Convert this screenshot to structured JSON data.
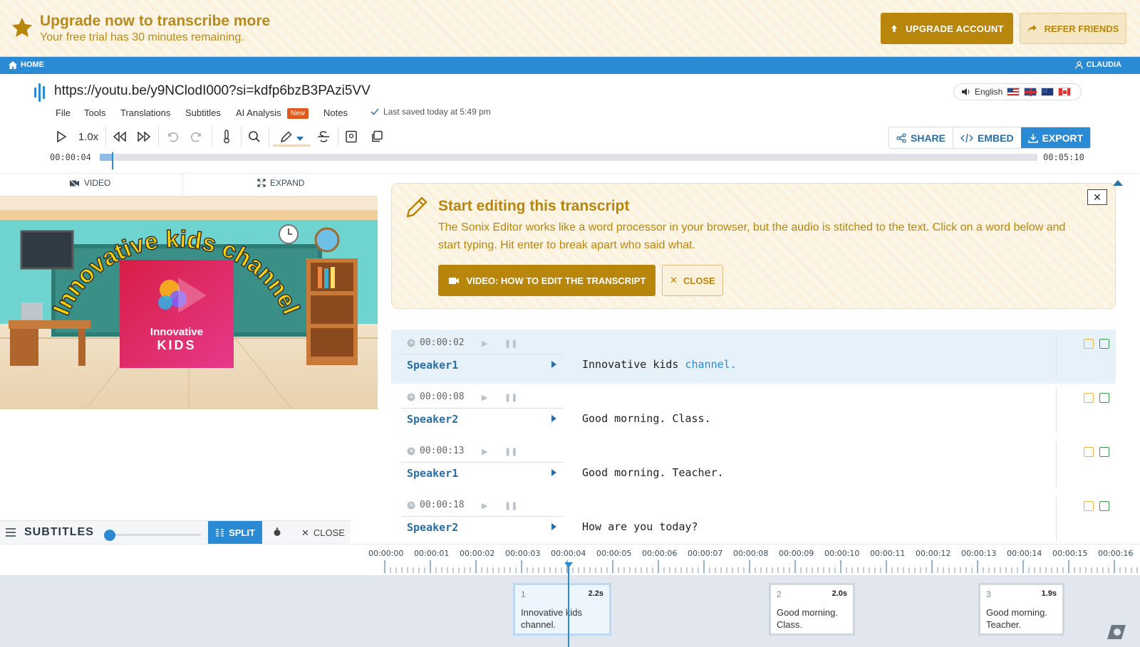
{
  "banner": {
    "title": "Upgrade now to transcribe more",
    "subtitle": "Your free trial has 30 minutes remaining.",
    "upgrade_label": "UPGRADE ACCOUNT",
    "refer_label": "REFER FRIENDS",
    "accent": "#b8860b"
  },
  "nav": {
    "home_label": "HOME",
    "user_label": "CLAUDIA",
    "color": "#2a8ad4"
  },
  "header": {
    "file_title": "https://youtu.be/y9NClodI000?si=kdfp6bzB3PAzi5VV",
    "language": "English",
    "menu": [
      "File",
      "Tools",
      "Translations",
      "Subtitles",
      "AI Analysis",
      "Notes"
    ],
    "new_badge": "New",
    "saved_status": "Last saved today at 5:49 pm"
  },
  "toolbar": {
    "speed": "1.0x",
    "share_label": "SHARE",
    "embed_label": "EMBED",
    "export_label": "EXPORT"
  },
  "playback": {
    "current_time": "00:00:04",
    "total_time": "00:05:10",
    "progress_fraction": 0.013
  },
  "video_panel": {
    "video_tab": "VIDEO",
    "expand_tab": "EXPAND",
    "thumb_title": "Innovative kids channel",
    "thumb_brand_1": "Innovative",
    "thumb_brand_2": "KIDS"
  },
  "tip": {
    "title": "Start editing this transcript",
    "body": "The Sonix Editor works like a word processor in your browser, but the audio is stitched to the text. Click on a word below and start typing. Hit enter to break apart who said what.",
    "video_button": "VIDEO: HOW TO EDIT THE TRANSCRIPT",
    "close_button": "CLOSE"
  },
  "transcript": [
    {
      "time": "00:00:02",
      "speaker": "Speaker1",
      "text": "Innovative kids ",
      "highlight": "channel.",
      "active": true
    },
    {
      "time": "00:00:08",
      "speaker": "Speaker2",
      "text": "Good morning. Class.",
      "highlight": "",
      "active": false
    },
    {
      "time": "00:00:13",
      "speaker": "Speaker1",
      "text": "Good morning. Teacher.",
      "highlight": "",
      "active": false
    },
    {
      "time": "00:00:18",
      "speaker": "Speaker2",
      "text": "How are you today?",
      "highlight": "",
      "active": false
    }
  ],
  "subtitles_bar": {
    "label": "SUBTITLES",
    "split_label": "SPLIT",
    "close_label": "CLOSE"
  },
  "timeline": {
    "ticks": [
      "00:00:00",
      "00:00:01",
      "00:00:02",
      "00:00:03",
      "00:00:04",
      "00:00:05",
      "00:00:06",
      "00:00:07",
      "00:00:08",
      "00:00:09",
      "00:00:10",
      "00:00:11",
      "00:00:12",
      "00:00:13",
      "00:00:14",
      "00:00:15",
      "00:00:16"
    ],
    "clips": [
      {
        "index": "1",
        "duration": "2.2s",
        "line1": "Innovative kids",
        "line2": "channel.",
        "active": true
      },
      {
        "index": "2",
        "duration": "2.0s",
        "line1": "Good morning.",
        "line2": "Class.",
        "active": false
      },
      {
        "index": "3",
        "duration": "1.9s",
        "line1": "Good morning.",
        "line2": "Teacher.",
        "active": false
      }
    ]
  }
}
